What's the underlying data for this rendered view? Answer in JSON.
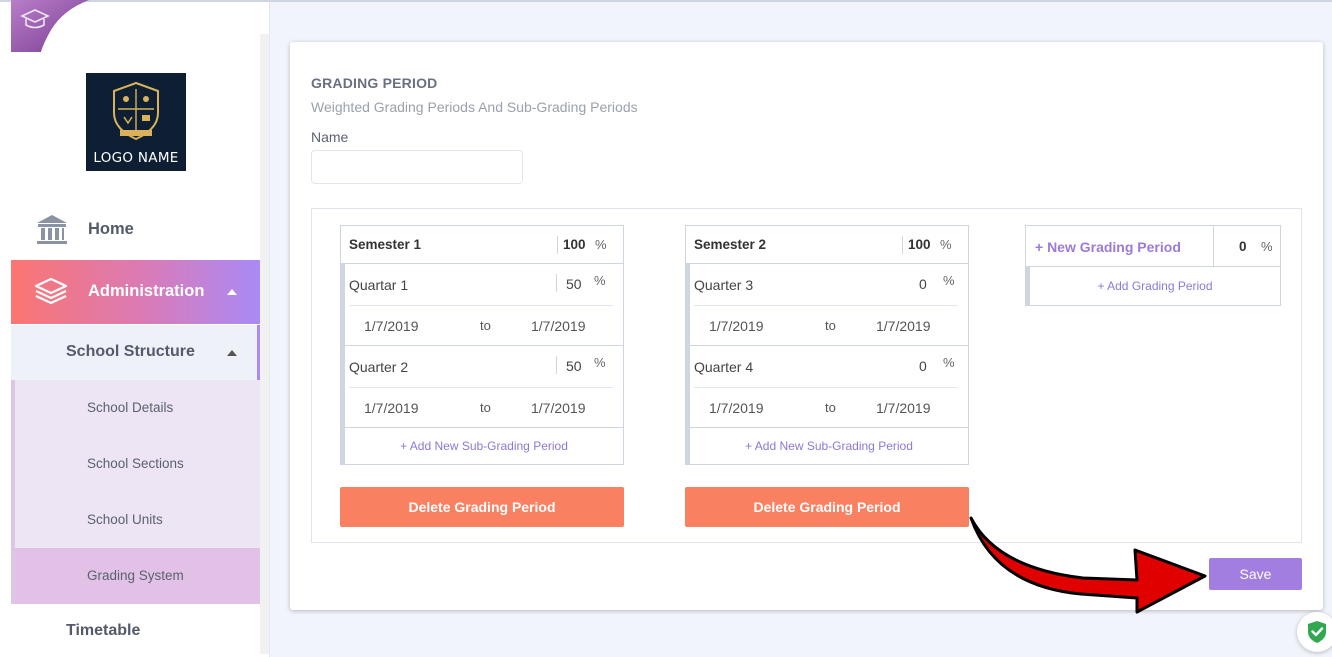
{
  "sidebar": {
    "logo_text": "LOGO NAME",
    "home_label": "Home",
    "admin_label": "Administration",
    "school_structure_label": "School Structure",
    "sub_items": [
      "School Details",
      "School Sections",
      "School Units",
      "Grading System"
    ],
    "timetable_label": "Timetable"
  },
  "main": {
    "title": "GRADING PERIOD",
    "subtitle": "Weighted Grading Periods And Sub-Grading Periods",
    "name_label": "Name",
    "name_value": "",
    "pct_symbol": "%",
    "to_label": "to",
    "add_sub_label": "+ Add New Sub-Grading Period",
    "delete_label": "Delete Grading Period",
    "semesters": [
      {
        "name": "Semester 1",
        "weight": "100",
        "quarters": [
          {
            "name": "Quartar 1",
            "weight": "50",
            "start": "1/7/2019",
            "end": "1/7/2019"
          },
          {
            "name": "Quarter 2",
            "weight": "50",
            "start": "1/7/2019",
            "end": "1/7/2019"
          }
        ]
      },
      {
        "name": "Semester 2",
        "weight": "100",
        "quarters": [
          {
            "name": "Quarter 3",
            "weight": "0",
            "start": "1/7/2019",
            "end": "1/7/2019"
          },
          {
            "name": "Quarter 4",
            "weight": "0",
            "start": "1/7/2019",
            "end": "1/7/2019"
          }
        ]
      }
    ],
    "new_grading_period": {
      "label": "+ New Grading Period",
      "weight": "0",
      "add_label": "+ Add Grading Period"
    },
    "save_label": "Save"
  },
  "colors": {
    "accent_purple": "#a27ee0",
    "delete_orange": "#fa8062",
    "admin_gradient_start": "#fb7571",
    "admin_gradient_end": "#a98af6",
    "arrow_red": "#e00000"
  }
}
